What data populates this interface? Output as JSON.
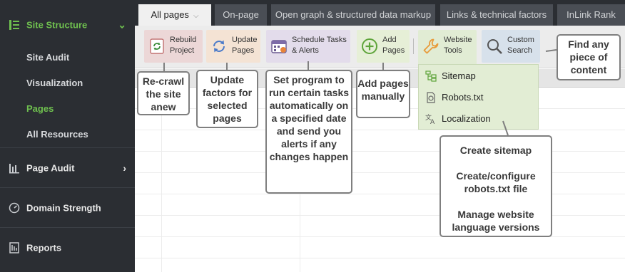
{
  "sidebar": {
    "header": "Site Structure",
    "sub_items": [
      {
        "label": "Site Audit"
      },
      {
        "label": "Visualization"
      },
      {
        "label": "Pages"
      },
      {
        "label": "All Resources"
      }
    ],
    "sections": [
      {
        "label": "Page Audit"
      },
      {
        "label": "Domain Strength"
      },
      {
        "label": "Reports"
      }
    ]
  },
  "tabs": [
    {
      "label": "All pages"
    },
    {
      "label": "On-page"
    },
    {
      "label": "Open graph & structured data markup"
    },
    {
      "label": "Links & technical factors"
    },
    {
      "label": "InLink Rank"
    }
  ],
  "toolbar": {
    "rebuild": "Rebuild\nProject",
    "update": "Update\nPages",
    "schedule": "Schedule Tasks\n& Alerts",
    "add": "Add\nPages",
    "tools": "Website\nTools",
    "custom": "Custom\nSearch"
  },
  "dropdown": [
    {
      "label": "Sitemap"
    },
    {
      "label": "Robots.txt"
    },
    {
      "label": "Localization"
    }
  ],
  "callouts": {
    "recrawl": "Re-crawl the site anew",
    "update": "Update factors for selected pages",
    "schedule": "Set program to run certain tasks automatically on a specified date and send you alerts if any changes happen",
    "add": "Add pages manually",
    "create_1": "Create sitemap",
    "create_2": "Create/configure robots.txt file",
    "create_3": "Manage website language versions",
    "find": "Find any piece of content"
  },
  "colors": {
    "sidebar_bg": "#2b2e33",
    "accent_green": "#6fc04f"
  }
}
